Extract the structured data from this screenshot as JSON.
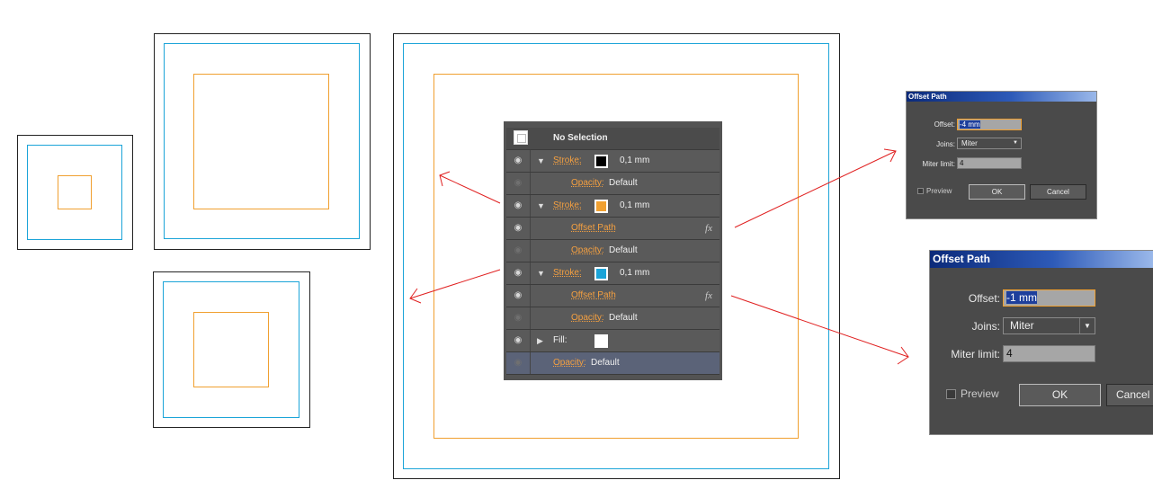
{
  "colors": {
    "cyan": "#1ba4d8",
    "orange": "#f0a030",
    "arrow": "#e02020"
  },
  "appearance_panel": {
    "header": "No Selection",
    "rows": [
      {
        "kind": "stroke",
        "label": "Stroke:",
        "weight": "0,1 mm",
        "swatch": "#000000"
      },
      {
        "kind": "opacity",
        "label": "Opacity:",
        "value": "Default"
      },
      {
        "kind": "stroke",
        "label": "Stroke:",
        "weight": "0,1 mm",
        "swatch": "#f0a030"
      },
      {
        "kind": "effect",
        "label": "Offset Path",
        "icon": "fx"
      },
      {
        "kind": "opacity",
        "label": "Opacity:",
        "value": "Default"
      },
      {
        "kind": "stroke",
        "label": "Stroke:",
        "weight": "0,1 mm",
        "swatch": "#1ba4d8"
      },
      {
        "kind": "effect",
        "label": "Offset Path",
        "icon": "fx"
      },
      {
        "kind": "opacity",
        "label": "Opacity:",
        "value": "Default"
      },
      {
        "kind": "fill",
        "label": "Fill:",
        "swatch": "#ffffff"
      },
      {
        "kind": "opacity",
        "label": "Opacity:",
        "value": "Default"
      }
    ]
  },
  "dialog_small": {
    "title": "Offset Path",
    "offset_label": "Offset:",
    "offset_value": "-4 mm",
    "joins_label": "Joins:",
    "joins_value": "Miter",
    "miter_label": "Miter limit:",
    "miter_value": "4",
    "preview_label": "Preview",
    "ok_label": "OK",
    "cancel_label": "Cancel"
  },
  "dialog_large": {
    "title": "Offset Path",
    "offset_label": "Offset:",
    "offset_value": "-1 mm",
    "joins_label": "Joins:",
    "joins_value": "Miter",
    "miter_label": "Miter limit:",
    "miter_value": "4",
    "preview_label": "Preview",
    "ok_label": "OK",
    "cancel_label": "Cancel"
  }
}
